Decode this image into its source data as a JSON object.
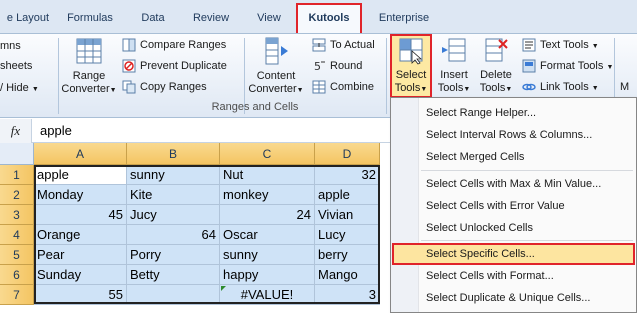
{
  "tabs": [
    {
      "label": "e Layout"
    },
    {
      "label": "Formulas"
    },
    {
      "label": "Data"
    },
    {
      "label": "Review"
    },
    {
      "label": "View"
    },
    {
      "label": "Kutools"
    },
    {
      "label": "Enterprise"
    }
  ],
  "ribbon": {
    "left_partial": [
      "mns",
      "sheets",
      "/ Hide"
    ],
    "range_converter": {
      "line1": "Range",
      "line2": "Converter"
    },
    "compare_ranges": "Compare Ranges",
    "prevent_duplicate": "Prevent Duplicate",
    "copy_ranges": "Copy Ranges",
    "content_converter": {
      "line1": "Content",
      "line2": "Converter"
    },
    "to_actual": "To Actual",
    "round": "Round",
    "combine": "Combine",
    "group_ranges_cells": "Ranges and Cells",
    "select_tools": {
      "line1": "Select",
      "line2": "Tools"
    },
    "insert_tools": {
      "line1": "Insert",
      "line2": "Tools"
    },
    "delete_tools": {
      "line1": "Delete",
      "line2": "Tools"
    },
    "text_tools": "Text Tools",
    "format_tools": "Format Tools",
    "link_tools": "Link Tools",
    "right_partial": "M"
  },
  "formula_bar": {
    "fx": "fx",
    "value": "apple"
  },
  "grid": {
    "columns": [
      "A",
      "B",
      "C",
      "D"
    ],
    "rows": [
      "1",
      "2",
      "3",
      "4",
      "5",
      "6",
      "7"
    ],
    "cells": [
      [
        "apple",
        "sunny",
        "Nut",
        "32"
      ],
      [
        "Monday",
        "Kite",
        "monkey",
        "apple"
      ],
      [
        "45",
        "Jucy",
        "24",
        "Vivian"
      ],
      [
        "Orange",
        "64",
        "Oscar",
        "Lucy"
      ],
      [
        "Pear",
        "Porry",
        "sunny",
        "berry"
      ],
      [
        "Sunday",
        "Betty",
        "happy",
        "Mango"
      ],
      [
        "55",
        "",
        "#VALUE!",
        "3"
      ]
    ]
  },
  "menu": {
    "items": [
      "Select Range Helper...",
      "Select Interval Rows & Columns...",
      "Select Merged Cells",
      "Select Cells with Max & Min Value...",
      "Select Cells with Error Value",
      "Select Unlocked Cells",
      "Select Specific Cells...",
      "Select Cells with Format...",
      "Select Duplicate & Unique Cells..."
    ]
  },
  "colors": {
    "highlight_border": "#e0242a",
    "selection_fill": "#cfe3f7",
    "header_fill": "#f4c563"
  }
}
